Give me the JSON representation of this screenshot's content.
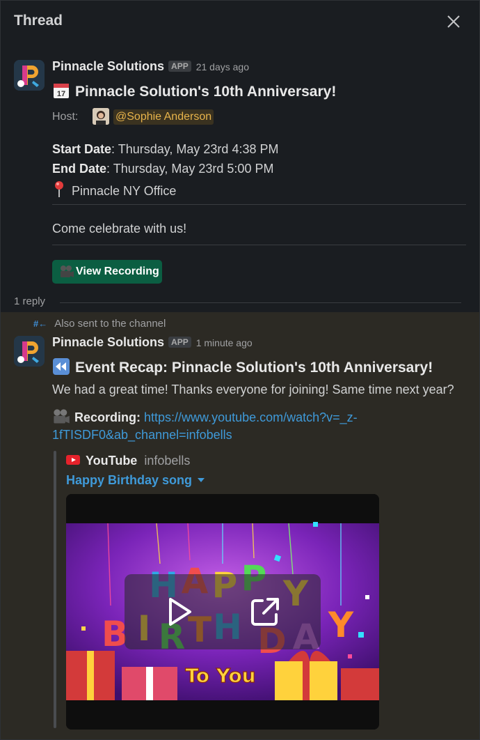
{
  "header": {
    "title": "Thread",
    "close_icon": "close-icon"
  },
  "parent_message": {
    "sender": "Pinnacle Solutions",
    "badge": "APP",
    "time": "21 days ago",
    "title_icon": "calendar-icon",
    "title": "Pinnacle Solution's 10th Anniversary!",
    "host_label": "Host:",
    "host_mention": "@Sophie Anderson",
    "start_label": "Start Date",
    "start_value": ": Thursday, May 23rd 4:38 PM",
    "end_label": "End Date",
    "end_value": ": Thursday, May 23rd 5:00 PM",
    "location_icon": "pin-icon",
    "location": "Pinnacle NY Office",
    "body": "Come celebrate with us!",
    "button_label": "View Recording",
    "button_color": "#0b5e42"
  },
  "thread": {
    "reply_count": "1 reply"
  },
  "reply_message": {
    "also_sent": "Also sent to the channel",
    "sender": "Pinnacle Solutions",
    "badge": "APP",
    "time": "1 minute ago",
    "title_icon": "rewind-icon",
    "title": "Event Recap: Pinnacle Solution's 10th Anniversary!",
    "body": "We had a great time! Thanks everyone for joining! Same time next year?",
    "recording_label": "Recording:",
    "recording_url_line1": "https://www.youtube.com/watch?v=_z-",
    "recording_url_line2": "1fTISDF0&ab_channel=infobells",
    "unfurl": {
      "service": "YouTube",
      "channel": "infobells",
      "video_title": "Happy Birthday song",
      "thumbnail_text": "HAPPY BIRTHDAY",
      "thumbnail_subtext": "To You"
    }
  },
  "colors": {
    "background": "#1a1d21",
    "highlight": "#2c2a24",
    "link": "#3f9ad9",
    "mention_text": "#e8b44b"
  }
}
